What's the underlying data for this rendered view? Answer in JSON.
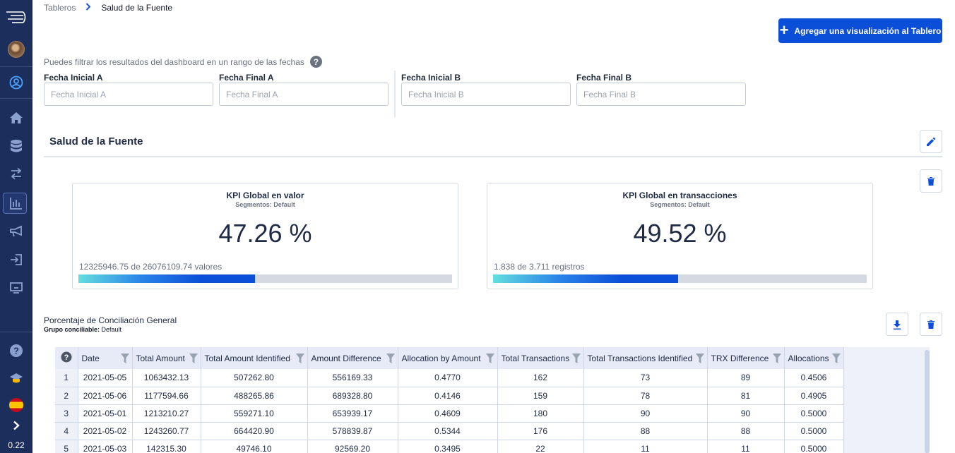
{
  "sidebar": {
    "version": "0.22",
    "items": [
      {
        "name": "logo-icon"
      },
      {
        "name": "avatar"
      },
      {
        "name": "user-circle-icon"
      },
      {
        "name": "home-icon"
      },
      {
        "name": "database-icon"
      },
      {
        "name": "transfer-arrows-icon"
      },
      {
        "name": "bar-chart-icon"
      },
      {
        "name": "megaphone-icon"
      },
      {
        "name": "login-icon"
      },
      {
        "name": "monitor-icon"
      },
      {
        "name": "help-icon"
      },
      {
        "name": "graduation-cap-icon"
      },
      {
        "name": "spain-flag-icon"
      },
      {
        "name": "chevron-right-icon"
      }
    ]
  },
  "breadcrumb": {
    "parent": "Tableros",
    "current": "Salud de la Fuente"
  },
  "add_button_label": "Agregar una visualización al Tablero",
  "filter_hint": "Puedes filtrar los resultados del dashboard en un rango de las fechas",
  "dates": {
    "start_a": {
      "label": "Fecha Inicial A",
      "placeholder": "Fecha Inicial A"
    },
    "end_a": {
      "label": "Fecha Final A",
      "placeholder": "Fecha Final A"
    },
    "start_b": {
      "label": "Fecha Inicial B",
      "placeholder": "Fecha Inicial B"
    },
    "end_b": {
      "label": "Fecha Final B",
      "placeholder": "Fecha Final B"
    }
  },
  "section_title": "Salud de la Fuente",
  "kpis": [
    {
      "title": "KPI Global en valor",
      "segment": "Segmentos: Default",
      "value": "47.26 %",
      "detail": "12325946.75 de 26076109.74 valores",
      "fraction": 0.4726
    },
    {
      "title": "KPI Global en transacciones",
      "segment": "Segmentos: Default",
      "value": "49.52 %",
      "detail": "1.838 de 3.711 registros",
      "fraction": 0.4952
    }
  ],
  "table_widget": {
    "title": "Porcentaje de Conciliación General",
    "group_label": "Grupo conciliable:",
    "group_value": "Default",
    "columns": [
      "Date",
      "Total Amount",
      "Total Amount Identified",
      "Amount Difference",
      "Allocation by Amount",
      "Total Transactions",
      "Total Transactions Identified",
      "TRX Difference",
      "Allocations"
    ],
    "rows": [
      [
        "1",
        "2021-05-05",
        "1063432.13",
        "507262.80",
        "556169.33",
        "0.4770",
        "162",
        "73",
        "89",
        "0.4506"
      ],
      [
        "2",
        "2021-05-06",
        "1177594.66",
        "488265.86",
        "689328.80",
        "0.4146",
        "159",
        "78",
        "81",
        "0.4905"
      ],
      [
        "3",
        "2021-05-01",
        "1213210.27",
        "559271.10",
        "653939.17",
        "0.4609",
        "180",
        "90",
        "90",
        "0.5000"
      ],
      [
        "4",
        "2021-05-02",
        "1243260.77",
        "664420.90",
        "578839.87",
        "0.5344",
        "176",
        "88",
        "88",
        "0.5000"
      ],
      [
        "5",
        "2021-05-03",
        "142315.30",
        "49746.10",
        "92569.20",
        "0.3495",
        "22",
        "11",
        "11",
        "0.5000"
      ]
    ]
  },
  "colors": {
    "sidebar": "#1c2e5c",
    "primary": "#0b4ed8",
    "text": "#1f2a44"
  }
}
